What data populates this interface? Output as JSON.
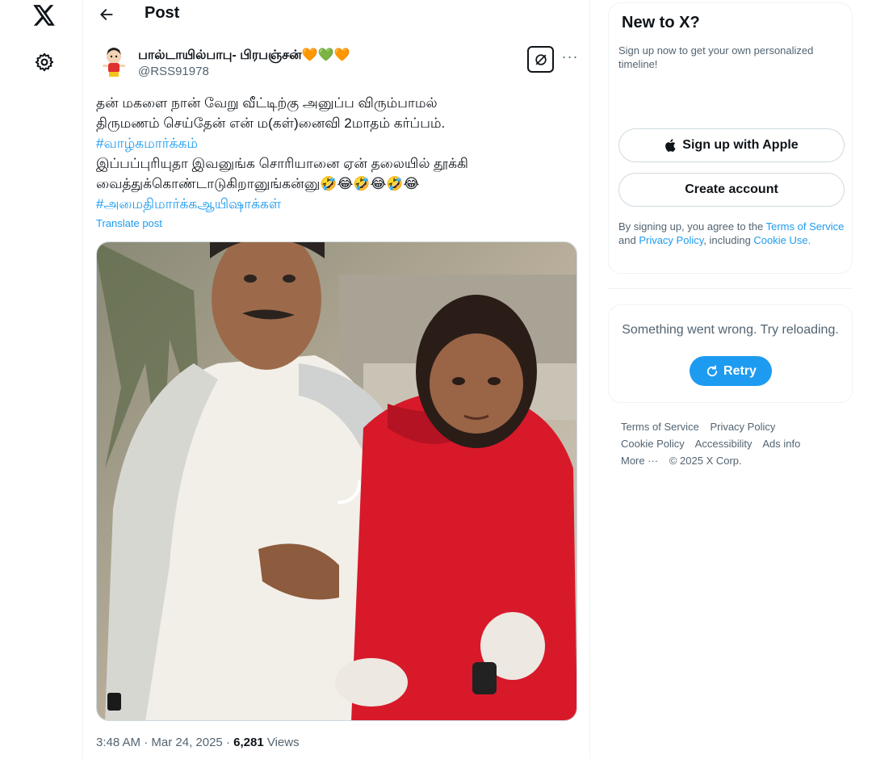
{
  "nav": {
    "logo_icon": "x-logo-icon",
    "settings_icon": "gear-icon"
  },
  "header": {
    "back_icon": "arrow-left-icon",
    "title": "Post"
  },
  "post": {
    "author_name": "பால்டாயில்பாபு- பிரபஞ்சன்🧡💚🧡",
    "author_handle": "@RSS91978",
    "grok_icon": "grok-icon",
    "more_label": "···",
    "text_lines": [
      "தன் மகளை நான் வேறு வீட்டிற்கு அனுப்ப விரும்பாமல்",
      "திருமணம் செய்தேன் என் ம(கள்)னைவி 2மாதம் கர்ப்பம்."
    ],
    "hashtag_1": "#வாழ்கமார்க்கம்",
    "text_lines_2": [
      "இப்பப்புரியுதா இவனுங்க சொரியானை ஏன் தலையில் தூக்கி",
      "வைத்துக்கொண்டாடுகிறானுங்கன்னு🤣😂🤣😂🤣😂"
    ],
    "hashtag_2": "#அமைதிமார்க்கஆயிஷாக்கள்",
    "translate_label": "Translate post",
    "time": "3:48 AM",
    "date": "Mar 24, 2025",
    "views_count": "6,281",
    "views_label": "Views"
  },
  "signup": {
    "title": "New to X?",
    "subtitle": "Sign up now to get your own personalized timeline!",
    "apple_button": "Sign up with Apple",
    "create_button": "Create account",
    "legal_prefix": "By signing up, you agree to the ",
    "terms_link": "Terms of Service",
    "legal_and": " and ",
    "privacy_link": "Privacy Policy",
    "legal_including": ", including ",
    "cookie_link": "Cookie Use",
    "legal_end": "."
  },
  "error": {
    "message": "Something went wrong. Try reloading.",
    "retry_label": "Retry"
  },
  "footer": {
    "links": [
      "Terms of Service",
      "Privacy Policy",
      "Cookie Policy",
      "Accessibility",
      "Ads info"
    ],
    "more_label": "More ···",
    "copyright": "© 2025 X Corp."
  },
  "colors": {
    "accent": "#1d9bf0",
    "text": "#0f1419",
    "muted": "#536471",
    "border": "#eff3f4"
  }
}
